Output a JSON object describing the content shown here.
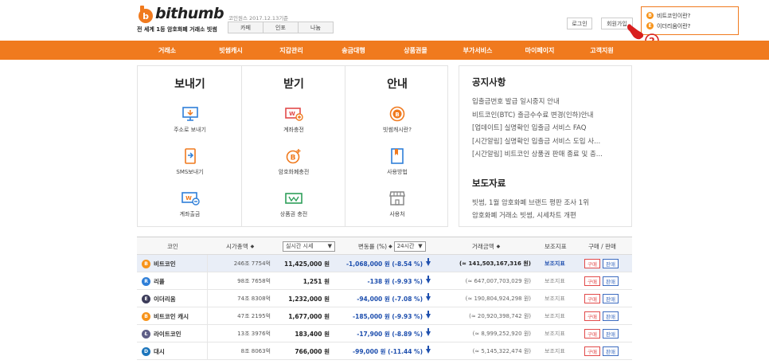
{
  "brand": {
    "logo_text": "bithumb",
    "tagline": "전 세계 1등 암호화폐 거래소 빗썸",
    "rate_date": "코인원스 2017.12.13기준",
    "currency_tabs": [
      "카페",
      "인포",
      "나눔"
    ]
  },
  "top_buttons": {
    "login": "로그인",
    "signup": "회원가입"
  },
  "promo": {
    "items": [
      "비트코인이란?",
      "이더리움이란?"
    ],
    "step": "2"
  },
  "nav": [
    "거래소",
    "빗썸캐시",
    "지갑관리",
    "송금대행",
    "상품권몰",
    "부가서비스",
    "마이페이지",
    "고객지원"
  ],
  "services": {
    "send": {
      "title": "보내기",
      "items": [
        "주소로 보내기",
        "SMS보내기",
        "계좌출금"
      ]
    },
    "receive": {
      "title": "받기",
      "items": [
        "계좌충전",
        "암호화폐충전",
        "상품권 충전"
      ]
    },
    "guide": {
      "title": "안내",
      "items": [
        "빗썸캐시란?",
        "사용방법",
        "사용처"
      ]
    }
  },
  "notice": {
    "title": "공지사항",
    "items": [
      "입출금번호 발급 일시중지 안내",
      "비트코인(BTC) 출금수수료 변경(인하)안내",
      "[업데이트] 실명확인 입출금 서비스 FAQ",
      "[시간알림] 실명확인 입출금 서비스 도입 사...",
      "[시간알림] 비트코인 상품권 판매 종료 및 충..."
    ]
  },
  "press": {
    "title": "보도자료",
    "items": [
      "빗썸, 1월 암호화폐 브랜드 평판 조사 1위",
      "암호화폐 거래소 빗썸, 시세차트 개편"
    ]
  },
  "table": {
    "headers": {
      "coin": "코인",
      "mcap": "시가총액",
      "price_select": "실시간 시세",
      "change": "변동률 (%)",
      "period_select": "24시간",
      "volume": "거래금액",
      "aux": "보조지표",
      "trade": "구매 / 판매"
    },
    "buy_label": "구매",
    "sell_label": "판매",
    "rows": [
      {
        "name": "비트코인",
        "symbol": "B",
        "color": "#f7931a",
        "mcap": "246조 7754억",
        "price": "11,425,000 원",
        "change": "-1,068,000 원 (-8.54 %)",
        "volume": "(≈ 141,503,167,316 원)",
        "aux": "보조지표",
        "highlight": true
      },
      {
        "name": "리플",
        "symbol": "R",
        "color": "#2f7fd8",
        "mcap": "98조 7658억",
        "price": "1,251 원",
        "change": "-138 원 (-9.93 %)",
        "volume": "(≈ 647,007,703,029 원)",
        "aux": "보조지표",
        "highlight": false
      },
      {
        "name": "이더리움",
        "symbol": "E",
        "color": "#3c3c5a",
        "mcap": "74조 8308억",
        "price": "1,232,000 원",
        "change": "-94,000 원 (-7.08 %)",
        "volume": "(≈ 190,804,924,298 원)",
        "aux": "보조지표",
        "highlight": false
      },
      {
        "name": "비트코인 캐시",
        "symbol": "B",
        "color": "#f7931a",
        "mcap": "47조 2195억",
        "price": "1,677,000 원",
        "change": "-185,000 원 (-9.93 %)",
        "volume": "(≈ 20,920,398,742 원)",
        "aux": "보조지표",
        "highlight": false
      },
      {
        "name": "라이트코인",
        "symbol": "Ł",
        "color": "#5d5d86",
        "mcap": "13조 3976억",
        "price": "183,400 원",
        "change": "-17,900 원 (-8.89 %)",
        "volume": "(≈ 8,999,252,920 원)",
        "aux": "보조지표",
        "highlight": false
      },
      {
        "name": "대시",
        "symbol": "D",
        "color": "#1c75bc",
        "mcap": "8조 8063억",
        "price": "766,000 원",
        "change": "-99,000 원 (-11.44 %)",
        "volume": "(≈ 5,145,322,474 원)",
        "aux": "보조지표",
        "highlight": false
      }
    ]
  }
}
